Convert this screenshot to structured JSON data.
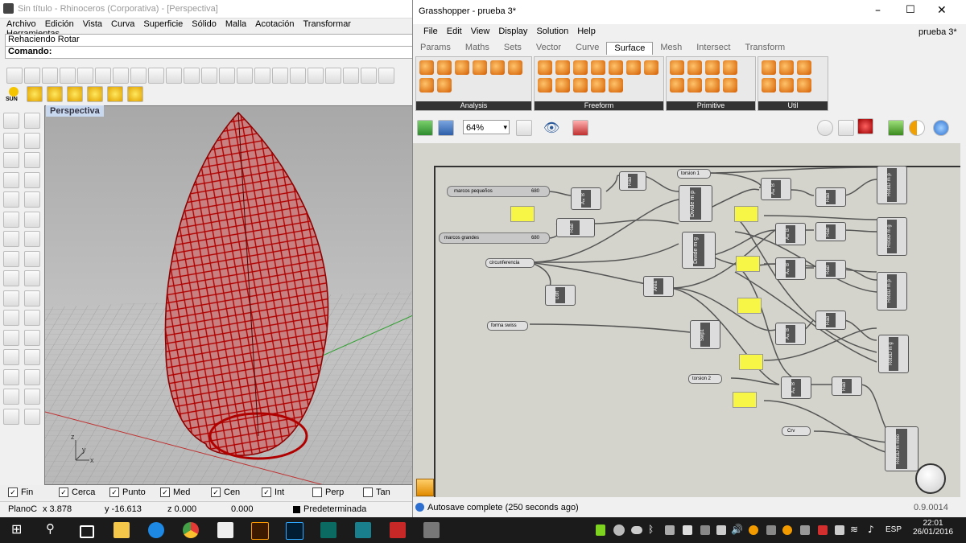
{
  "rhino": {
    "title": "Sin título - Rhinoceros (Corporativa) - [Perspectiva]",
    "menu": [
      "Archivo",
      "Edición",
      "Vista",
      "Curva",
      "Superficie",
      "Sólido",
      "Malla",
      "Acotación",
      "Transformar",
      "Herramientas"
    ],
    "command_history": "Rehaciendo Rotar",
    "command_prompt": "Comando:",
    "viewport_label": "Perspectiva",
    "toolbar2_sun_label": "SUN",
    "osnaps": [
      {
        "label": "Fin",
        "checked": true
      },
      {
        "label": "Cerca",
        "checked": true
      },
      {
        "label": "Punto",
        "checked": true
      },
      {
        "label": "Med",
        "checked": true
      },
      {
        "label": "Cen",
        "checked": true
      },
      {
        "label": "Int",
        "checked": true
      },
      {
        "label": "Perp",
        "checked": false
      },
      {
        "label": "Tan",
        "checked": false
      }
    ],
    "status": {
      "cplane": "PlanoC",
      "x": "x 3.878",
      "y": "y -16.613",
      "z": "z 0.000",
      "dist": "0.000",
      "layer": "Predeterminada"
    },
    "axis_z": "z",
    "axis_y": "y",
    "axis_x": "x"
  },
  "gh": {
    "title": "Grasshopper - prueba 3*",
    "doc_name": "prueba 3*",
    "menu": [
      "File",
      "Edit",
      "View",
      "Display",
      "Solution",
      "Help"
    ],
    "tabs": [
      "Params",
      "Maths",
      "Sets",
      "Vector",
      "Curve",
      "Surface",
      "Mesh",
      "Intersect",
      "Transform"
    ],
    "active_tab": "Surface",
    "ribbon_groups": [
      "Analysis",
      "Freeform",
      "Primitive",
      "Util"
    ],
    "zoom": "64%",
    "status": "Autosave complete (250 seconds ago)",
    "version": "0.9.0014",
    "nodes": {
      "marcos_pequenos": "marcos pequeños",
      "marcos_pequenos_val": "680",
      "marcos_grandes": "marcos grandes",
      "marcos_grandes_val": "680",
      "circunferencia": "circunferencia",
      "forma_swiss": "forma swiss",
      "torsion1": "torsion 1",
      "torsion2": "torsion 2",
      "crv": "Crv",
      "axb": "A×B",
      "rad": "Rad",
      "divide_mp": "Divide m p",
      "divide_mg": "Divide m g",
      "area": "Area",
      "loft": "Loft",
      "swp1": "Swp1",
      "rot3d_mp": "Rot3D m p",
      "rot3d_mg": "Rot3D m g",
      "rot3d_mmbo": "Rot3D m mbo"
    }
  },
  "taskbar": {
    "time": "22:01",
    "date": "26/01/2016",
    "lang": "ESP"
  },
  "colors": {
    "mesh": "#b00000",
    "panel_yellow": "#f7f545",
    "canvas": "#d4d4cc"
  }
}
